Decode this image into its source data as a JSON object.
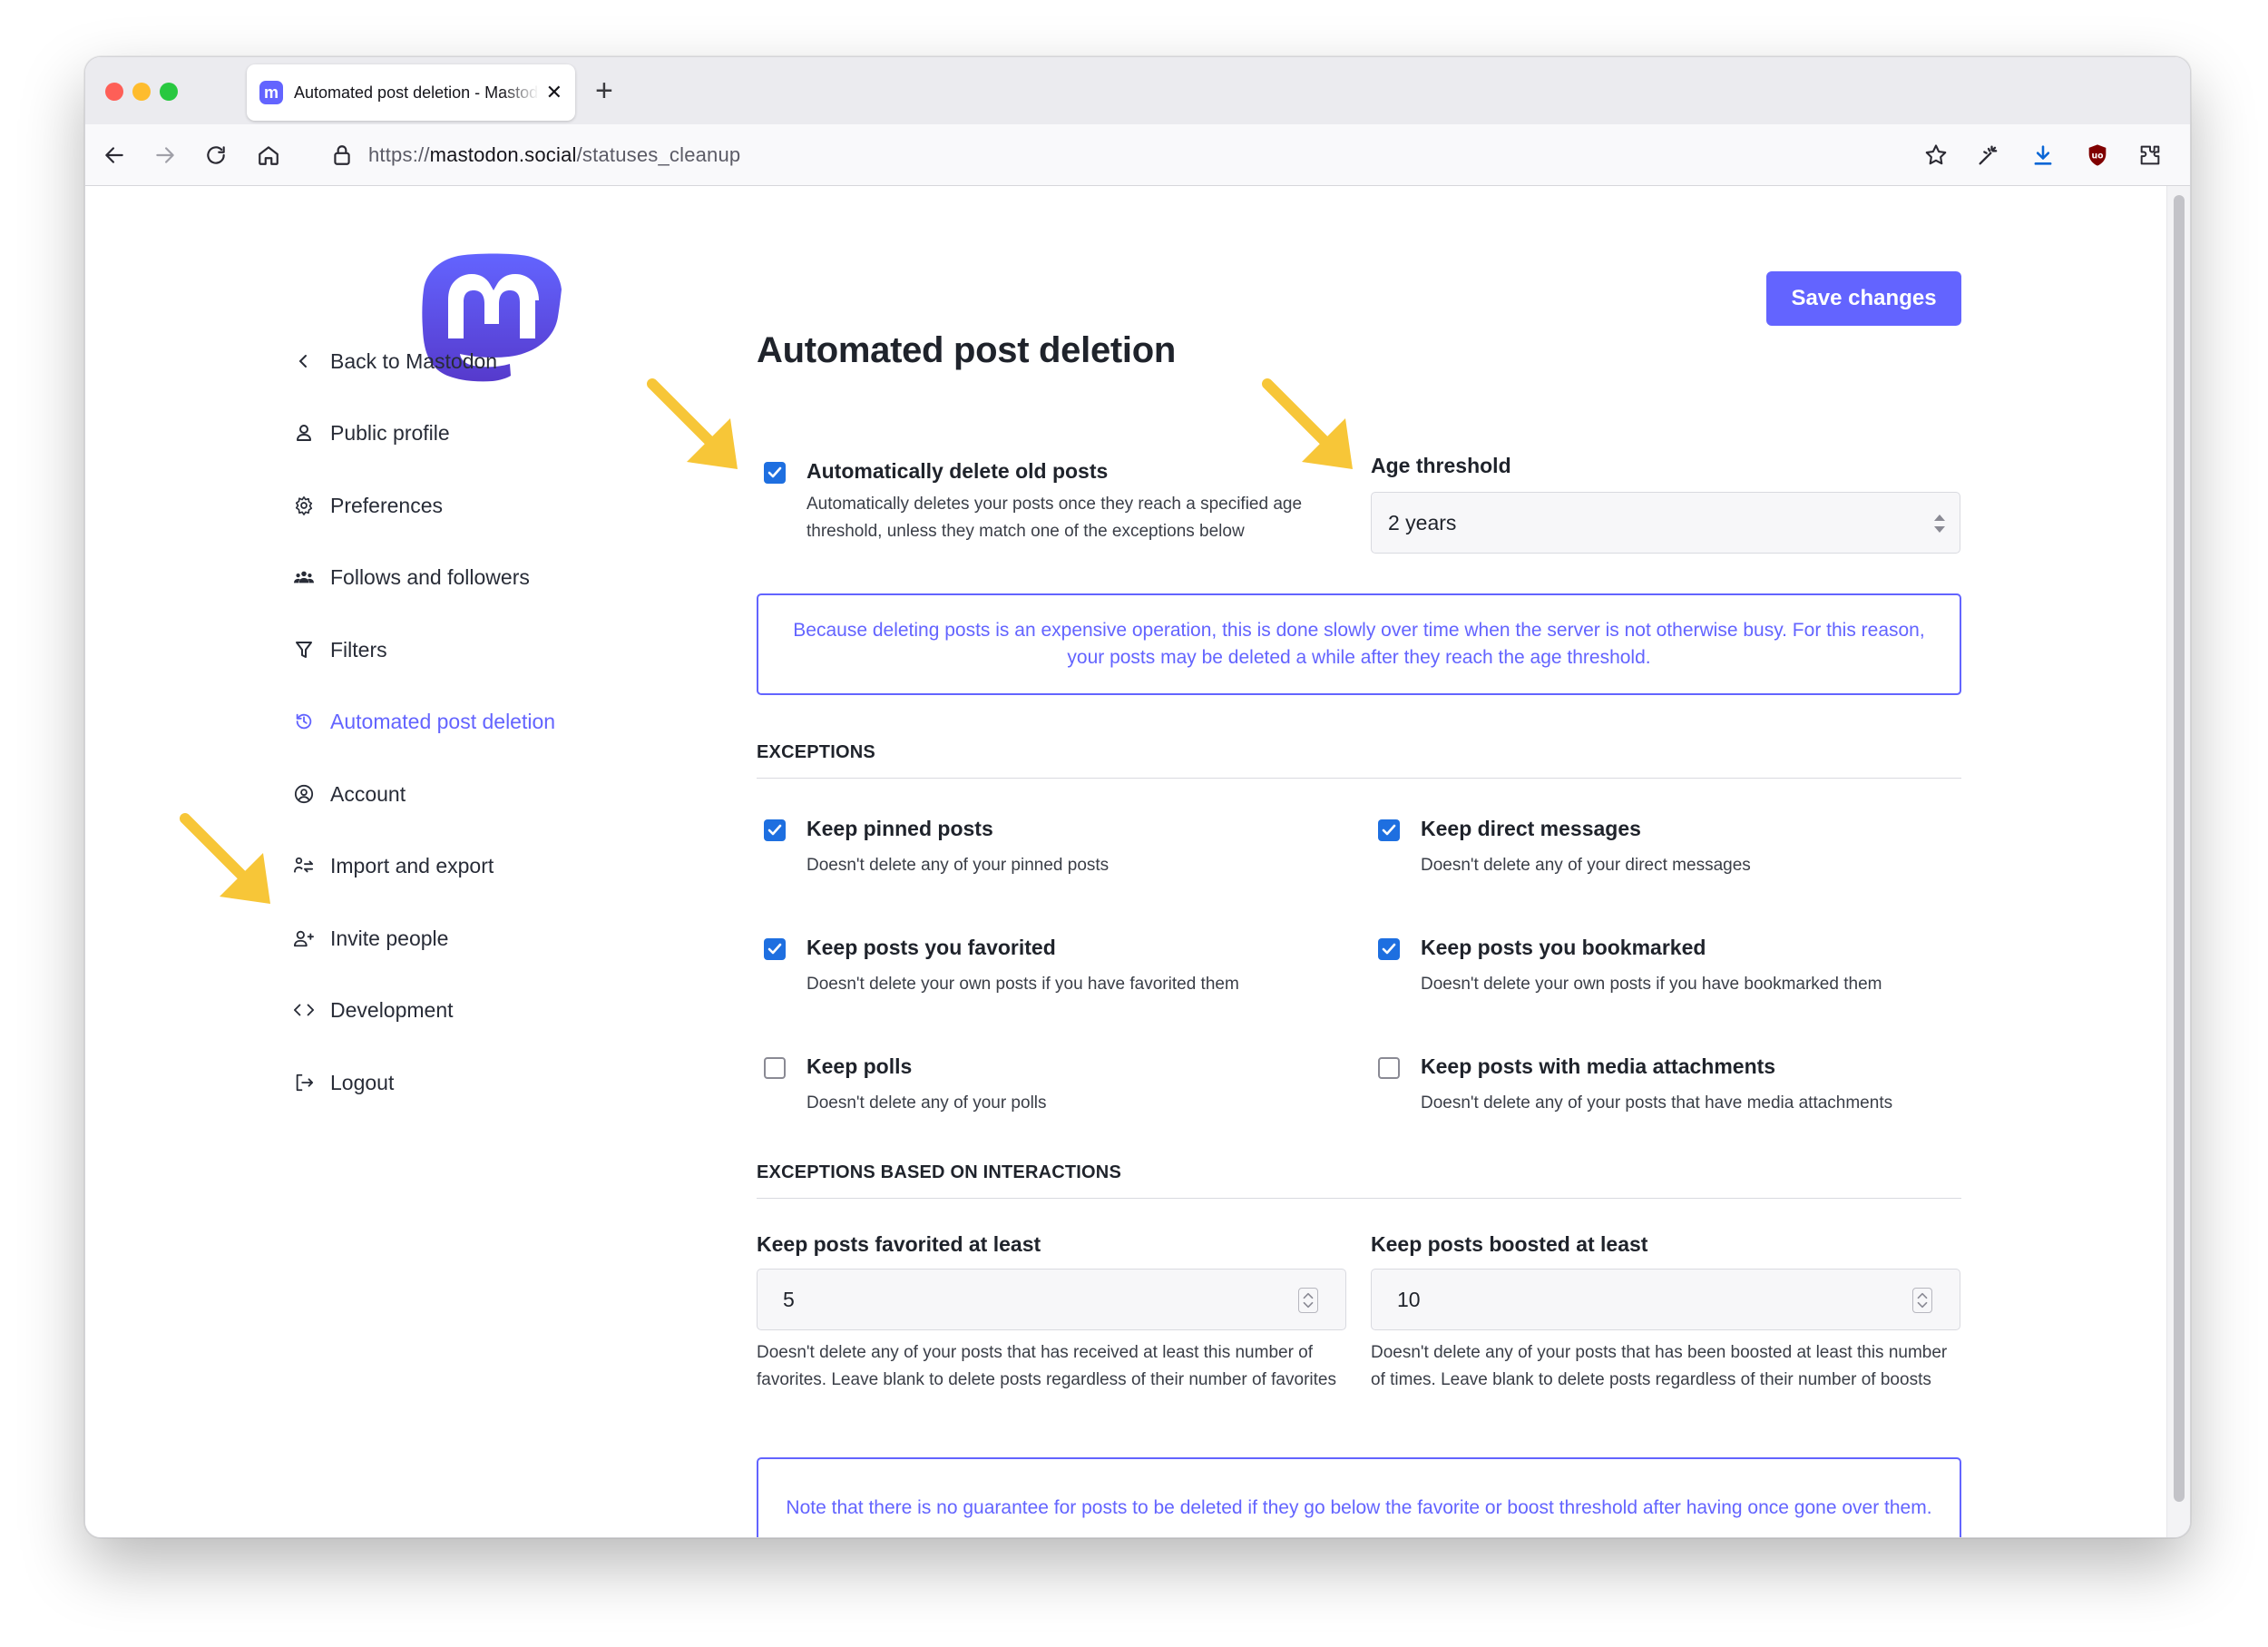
{
  "browser": {
    "tab_title": "Automated post deletion - Mastodon",
    "url_scheme": "https://",
    "url_host": "mastodon.social",
    "url_path": "/statuses_cleanup",
    "new_tab_label": "+",
    "tab_close_label": "✕"
  },
  "sidebar": {
    "items": [
      {
        "label": "Back to Mastodon",
        "icon": "chevron-left-icon"
      },
      {
        "label": "Public profile",
        "icon": "user-icon"
      },
      {
        "label": "Preferences",
        "icon": "gear-icon"
      },
      {
        "label": "Follows and followers",
        "icon": "people-icon"
      },
      {
        "label": "Filters",
        "icon": "filter-icon"
      },
      {
        "label": "Automated post deletion",
        "icon": "history-icon",
        "active": true
      },
      {
        "label": "Account",
        "icon": "account-circle-icon"
      },
      {
        "label": "Import and export",
        "icon": "import-export-icon"
      },
      {
        "label": "Invite people",
        "icon": "invite-user-icon"
      },
      {
        "label": "Development",
        "icon": "code-icon"
      },
      {
        "label": "Logout",
        "icon": "logout-icon"
      }
    ]
  },
  "main": {
    "title": "Automated post deletion",
    "save_label": "Save changes",
    "auto_delete": {
      "label": "Automatically delete old posts",
      "hint": "Automatically deletes your posts once they reach a specified age threshold, unless they match one of the exceptions below",
      "checked": true
    },
    "age_threshold": {
      "label": "Age threshold",
      "value": "2 years"
    },
    "notice_slow": "Because deleting posts is an expensive operation, this is done slowly over time when the server is not otherwise busy. For this reason, your posts may be deleted a while after they reach the age threshold.",
    "exceptions_title": "EXCEPTIONS",
    "exceptions": [
      {
        "label": "Keep pinned posts",
        "hint": "Doesn't delete any of your pinned posts",
        "checked": true
      },
      {
        "label": "Keep direct messages",
        "hint": "Doesn't delete any of your direct messages",
        "checked": true
      },
      {
        "label": "Keep posts you favorited",
        "hint": "Doesn't delete your own posts if you have favorited them",
        "checked": true
      },
      {
        "label": "Keep posts you bookmarked",
        "hint": "Doesn't delete your own posts if you have bookmarked them",
        "checked": true
      },
      {
        "label": "Keep polls",
        "hint": "Doesn't delete any of your polls",
        "checked": false
      },
      {
        "label": "Keep posts with media attachments",
        "hint": "Doesn't delete any of your posts that have media attachments",
        "checked": false
      }
    ],
    "interactions_title": "EXCEPTIONS BASED ON INTERACTIONS",
    "min_favs": {
      "label": "Keep posts favorited at least",
      "value": "5",
      "hint": "Doesn't delete any of your posts that has received at least this number of favorites. Leave blank to delete posts regardless of their number of favorites"
    },
    "min_reblogs": {
      "label": "Keep posts boosted at least",
      "value": "10",
      "hint": "Doesn't delete any of your posts that has been boosted at least this number of times. Leave blank to delete posts regardless of their number of boosts"
    },
    "notice_guarantee": "Note that there is no guarantee for posts to be deleted if they go below the favorite or boost threshold after having once gone over them."
  },
  "colors": {
    "accent": "#6364ff",
    "checkbox": "#1e6fe0",
    "arrow": "#f7c638"
  }
}
